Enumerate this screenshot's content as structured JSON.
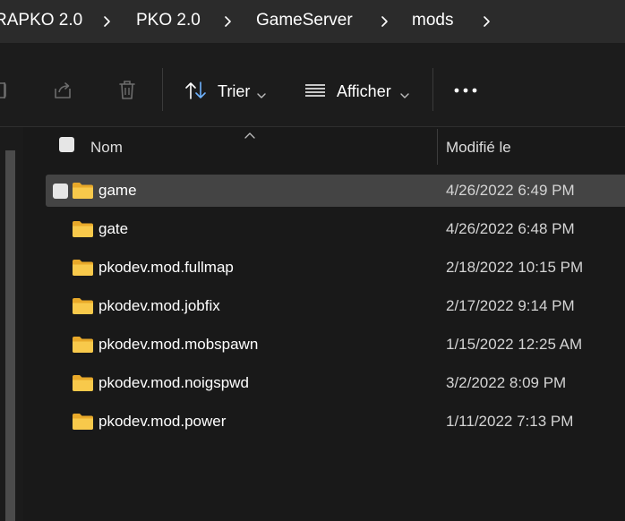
{
  "breadcrumb": {
    "items": [
      "RAPKO 2.0",
      "PKO 2.0",
      "GameServer",
      "mods"
    ],
    "separator_icon": "chevron-right-icon"
  },
  "toolbar": {
    "sort_label": "Trier",
    "view_label": "Afficher",
    "icons": [
      "rename-icon",
      "share-icon",
      "delete-icon",
      "sort-icon",
      "view-list-icon",
      "more-icon"
    ]
  },
  "columns": {
    "name": "Nom",
    "modified": "Modifié le"
  },
  "files": [
    {
      "name": "game",
      "modified": "4/26/2022 6:49 PM",
      "selected": true
    },
    {
      "name": "gate",
      "modified": "4/26/2022 6:48 PM",
      "selected": false
    },
    {
      "name": "pkodev.mod.fullmap",
      "modified": "2/18/2022 10:15 PM",
      "selected": false
    },
    {
      "name": "pkodev.mod.jobfix",
      "modified": "2/17/2022 9:14 PM",
      "selected": false
    },
    {
      "name": "pkodev.mod.mobspawn",
      "modified": "1/15/2022 12:25 AM",
      "selected": false
    },
    {
      "name": "pkodev.mod.noigspwd",
      "modified": "3/2/2022 8:09 PM",
      "selected": false
    },
    {
      "name": "pkodev.mod.power",
      "modified": "1/11/2022 7:13 PM",
      "selected": false
    }
  ],
  "colors": {
    "folder": "#F8C94B",
    "selection": "#444444",
    "background": "#191919"
  }
}
